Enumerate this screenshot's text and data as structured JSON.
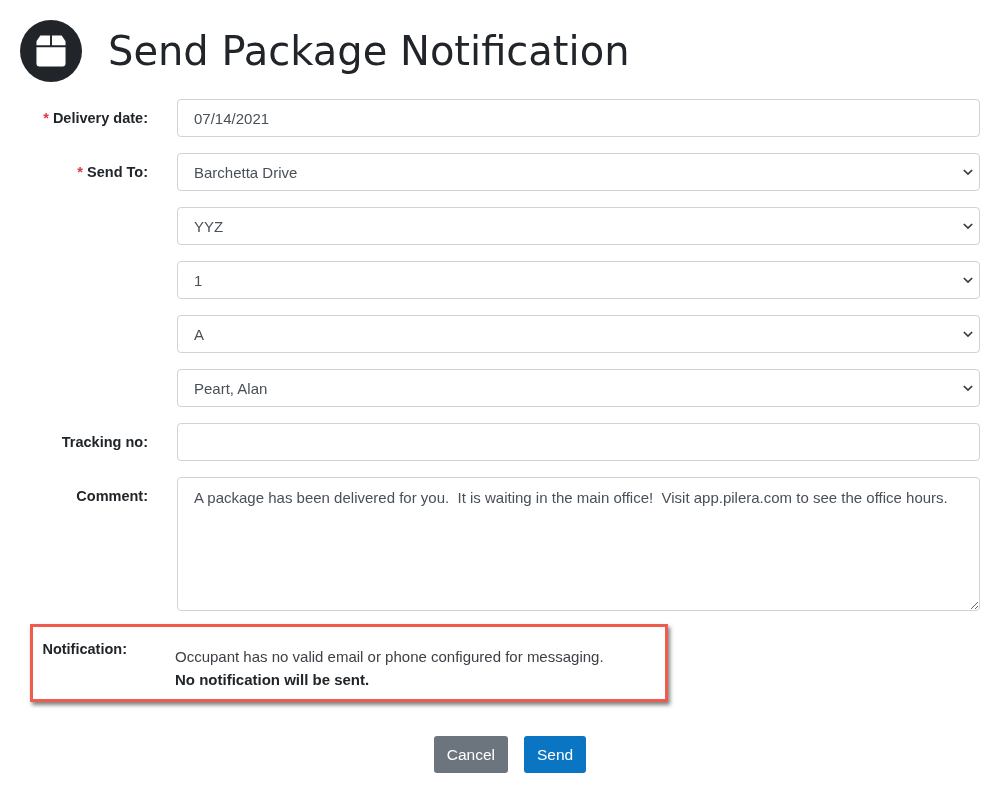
{
  "header": {
    "title": "Send Package Notification"
  },
  "fields": [
    {
      "label": "Delivery date:",
      "required_mark": "*",
      "kind": "input",
      "value": "07/14/2021"
    },
    {
      "label": "Send To:",
      "required_mark": "*",
      "kind": "select",
      "value": "Barchetta Drive"
    },
    {
      "kind": "select",
      "value": "YYZ"
    },
    {
      "kind": "select",
      "value": "1"
    },
    {
      "kind": "select",
      "value": "A"
    },
    {
      "kind": "select",
      "value": "Peart, Alan"
    },
    {
      "label": "Tracking no:",
      "kind": "input"
    },
    {
      "label": "Comment:",
      "kind": "textarea",
      "value": "A package has been delivered for you.  It is waiting in the main office!  Visit app.pilera.com to see the office hours."
    }
  ],
  "notification": {
    "label": "Notification:",
    "message": "Occupant has no valid email or phone configured for messaging.",
    "warning": "No notification will be sent."
  },
  "buttons": [
    {
      "label": "Cancel",
      "kind": "secondary"
    },
    {
      "label": "Send",
      "kind": "primary"
    }
  ]
}
